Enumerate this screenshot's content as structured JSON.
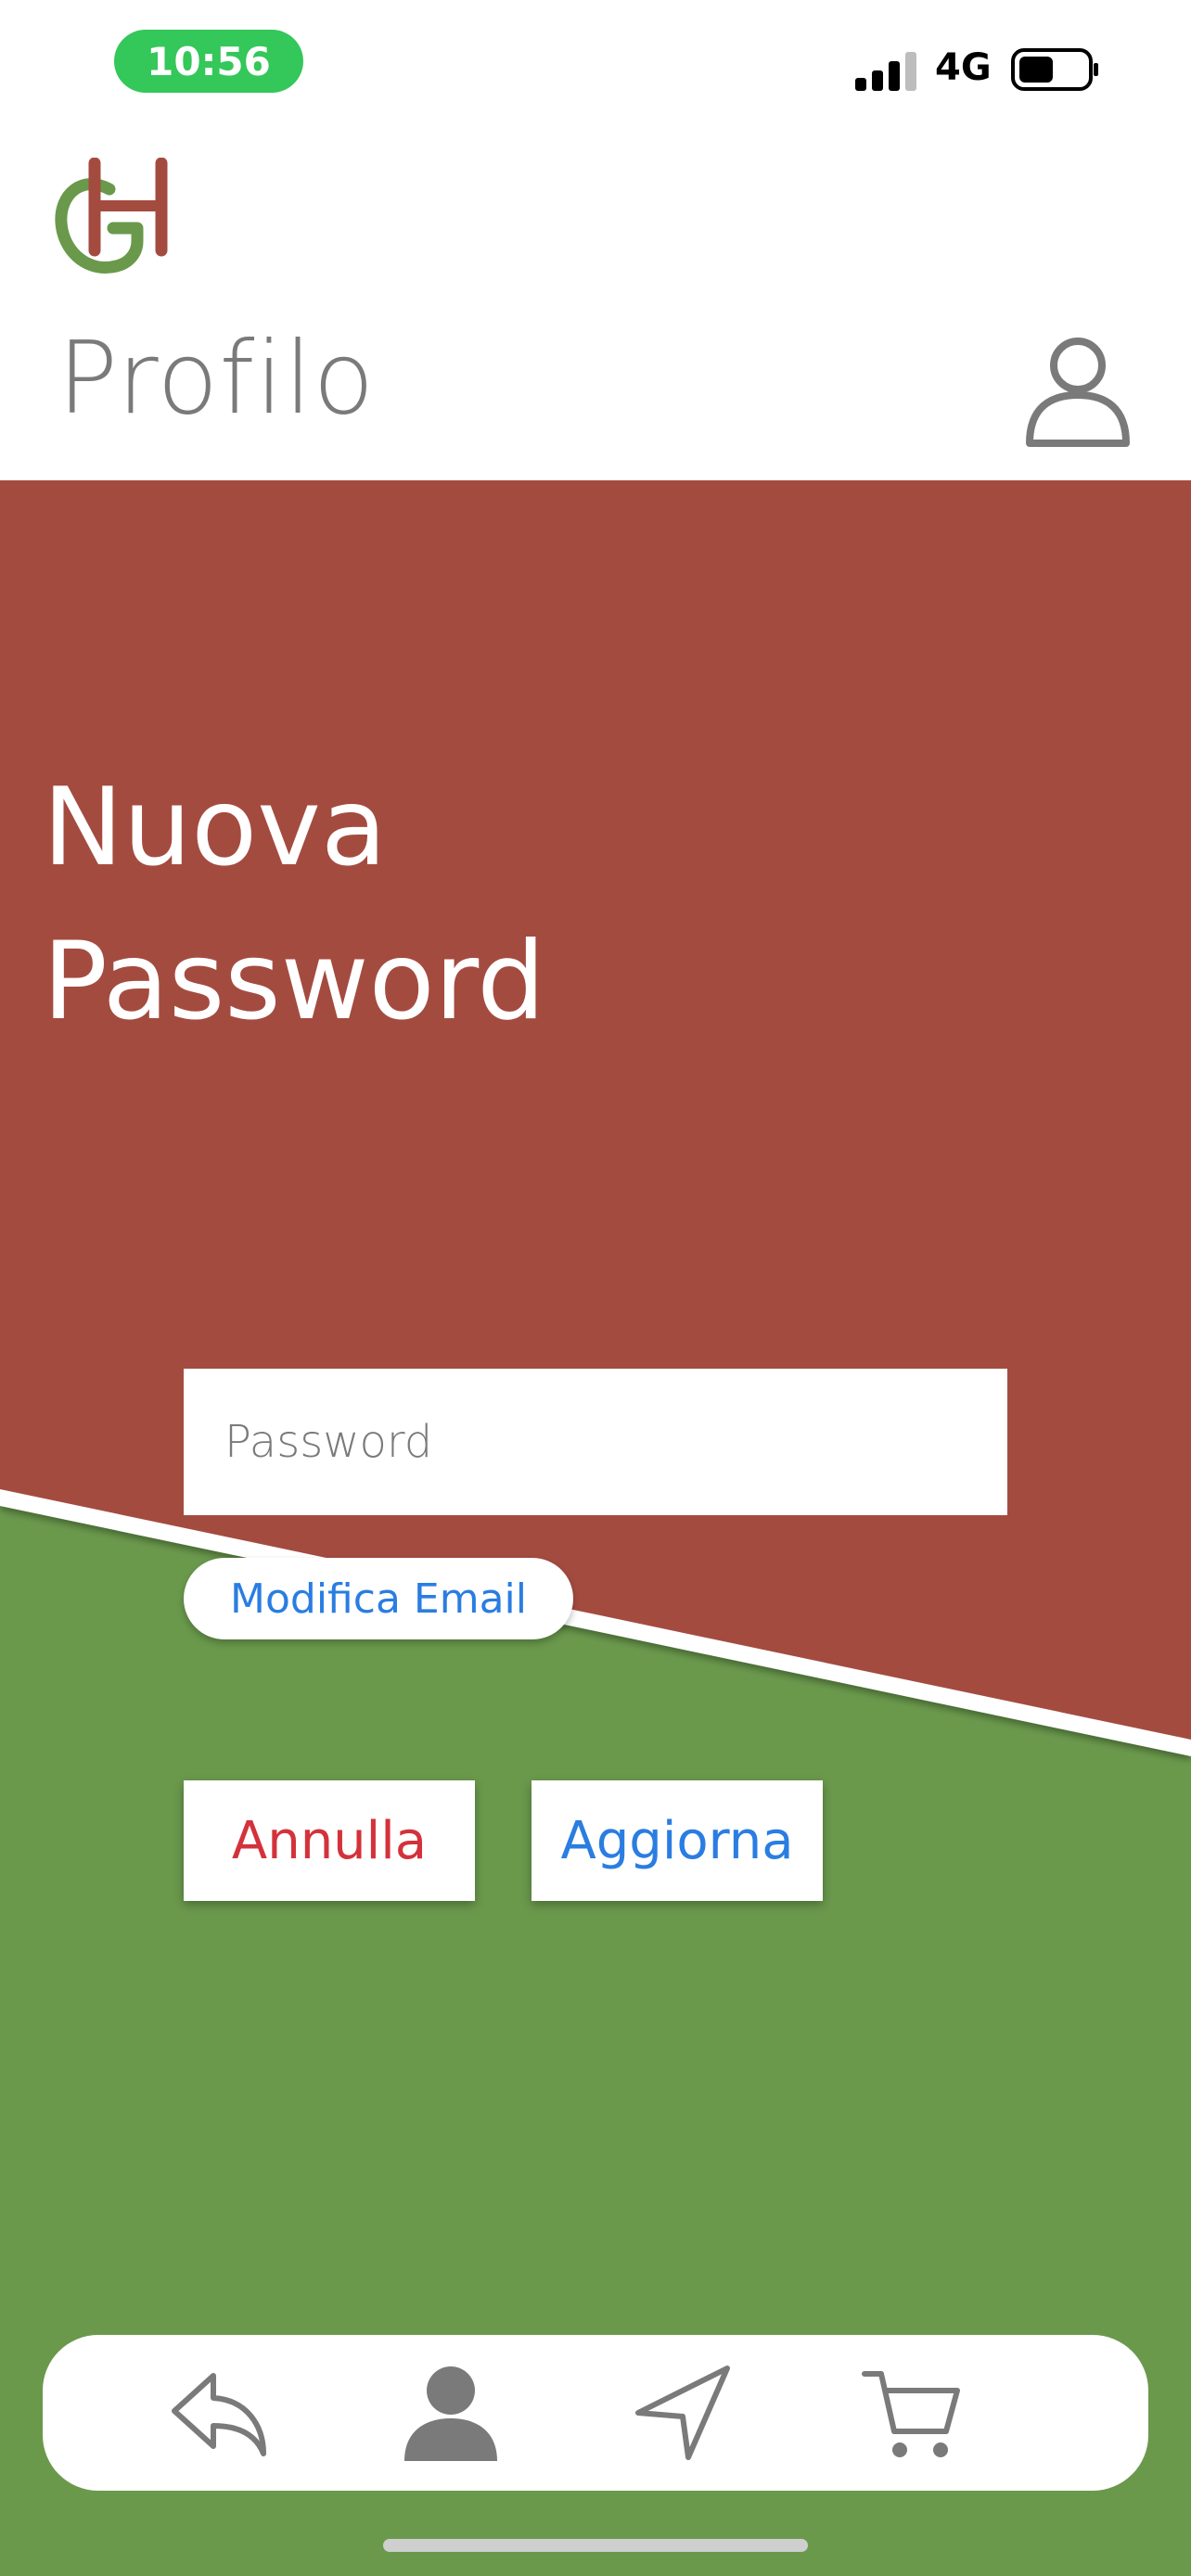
{
  "status_bar": {
    "time": "10:56",
    "network": "4G"
  },
  "header": {
    "title": "Profilo",
    "logo_letters": "GH"
  },
  "hero": {
    "title_line1": "Nuova",
    "title_line2": "Password"
  },
  "form": {
    "password_placeholder": "Password",
    "modify_email_label": "Modifica Email",
    "cancel_label": "Annulla",
    "update_label": "Aggiorna"
  },
  "bottom_nav": {
    "items": [
      "back-icon",
      "profile-icon",
      "location-arrow-icon",
      "cart-icon"
    ]
  },
  "colors": {
    "red": "#a44b40",
    "green": "#6a994c",
    "accent_blue": "#2a7de1",
    "accent_red": "#d3323b"
  }
}
